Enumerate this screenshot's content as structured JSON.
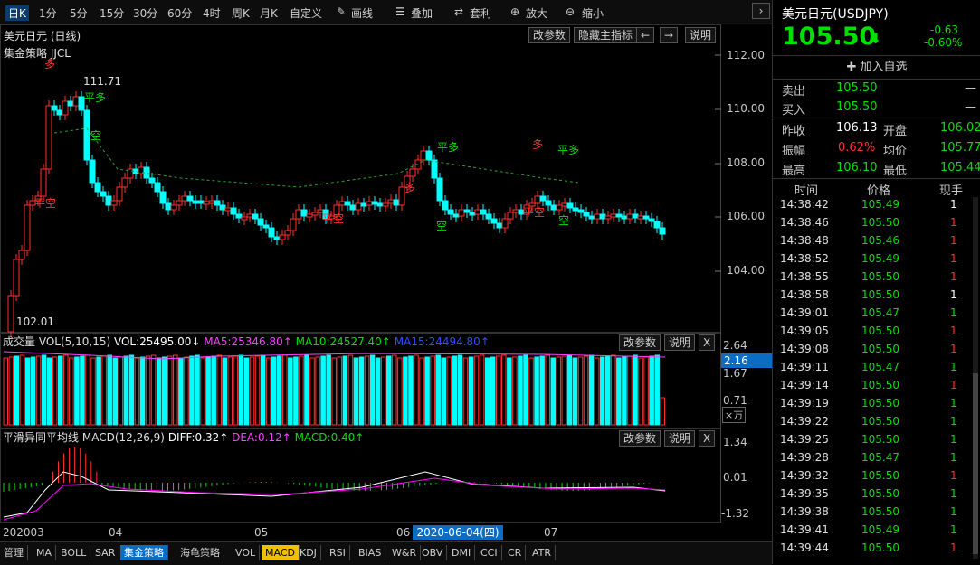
{
  "toolbar": {
    "periods": [
      "日K",
      "1分",
      "5分",
      "15分",
      "30分",
      "60分",
      "4时",
      "周K",
      "月K",
      "自定义"
    ],
    "tools": [
      "画线",
      "叠加",
      "套利",
      "放大",
      "缩小"
    ],
    "active_period": "日K"
  },
  "main_chart": {
    "symbol_title": "美元日元 (日线)",
    "buttons": [
      "改参数",
      "隐藏主指标",
      "←",
      "→",
      "说明"
    ],
    "indicator_label": "集金策略 JJCL",
    "price_axis": [
      "112.00",
      "110.00",
      "108.00",
      "106.00",
      "104.00"
    ],
    "high_label": "111.71",
    "low_label": "102.01",
    "signals": [
      "多",
      "平空",
      "平多",
      "空",
      "平空",
      "多",
      "平多",
      "空",
      "多",
      "平空",
      "平多",
      "空"
    ]
  },
  "volume_panel": {
    "title": "成交量",
    "vol_label": "VOL(5,10,15)",
    "vol_value": "VOL:25495.00↓",
    "ma5": "MA5:25346.80↑",
    "ma10": "MA10:24527.40↑",
    "ma15": "MA15:24494.80↑",
    "buttons": [
      "改参数",
      "说明",
      "X"
    ],
    "axis": [
      "2.64",
      "1.67",
      "0.71"
    ],
    "current": "2.16",
    "unit": "×万"
  },
  "macd_panel": {
    "title": "平滑异同平均线",
    "macd_label": "MACD(12,26,9)",
    "diff": "DIFF:0.32↑",
    "dea": "DEA:0.12↑",
    "macd": "MACD:0.40↑",
    "buttons": [
      "改参数",
      "说明",
      "X"
    ],
    "axis": [
      "1.34",
      "0.01",
      "-1.32"
    ]
  },
  "date_axis": {
    "labels": [
      "202003",
      "04",
      "05",
      "06",
      "07"
    ],
    "cursor_date": "2020-06-04(四)"
  },
  "bottom_tabs": [
    "管理",
    "MA",
    "BOLL",
    "SAR",
    "集金策略",
    "海龟策略",
    "VOL",
    "MACD",
    "KDJ",
    "RSI",
    "BIAS",
    "W&R",
    "OBV",
    "DMI",
    "CCI",
    "CR",
    "ATR"
  ],
  "quote": {
    "name": "美元日元",
    "code": "(USDJPY)",
    "price": "105.50",
    "arrow": "⬇",
    "change": "-0.63",
    "change_pct": "-0.60%",
    "add_watch": "✚ 加入自选",
    "sell_label": "卖出",
    "sell_price": "105.50",
    "sell_vol": "—",
    "buy_label": "买入",
    "buy_price": "105.50",
    "buy_vol": "—",
    "stats": [
      {
        "l1": "昨收",
        "v1": "106.13",
        "l2": "开盘",
        "v2": "106.02"
      },
      {
        "l1": "振幅",
        "v1": "0.62%",
        "l2": "均价",
        "v2": "105.77"
      },
      {
        "l1": "最高",
        "v1": "106.10",
        "l2": "最低",
        "v2": "105.44"
      }
    ]
  },
  "trades": {
    "headers": [
      "时间",
      "价格",
      "现手"
    ],
    "rows": [
      [
        "14:38:42",
        "105.49",
        "1"
      ],
      [
        "14:38:46",
        "105.50",
        "1"
      ],
      [
        "14:38:48",
        "105.46",
        "1"
      ],
      [
        "14:38:52",
        "105.49",
        "1"
      ],
      [
        "14:38:55",
        "105.50",
        "1"
      ],
      [
        "14:38:58",
        "105.50",
        "1"
      ],
      [
        "14:39:01",
        "105.47",
        "1"
      ],
      [
        "14:39:05",
        "105.50",
        "1"
      ],
      [
        "14:39:08",
        "105.50",
        "1"
      ],
      [
        "14:39:11",
        "105.47",
        "1"
      ],
      [
        "14:39:14",
        "105.50",
        "1"
      ],
      [
        "14:39:19",
        "105.50",
        "1"
      ],
      [
        "14:39:22",
        "105.50",
        "1"
      ],
      [
        "14:39:25",
        "105.50",
        "1"
      ],
      [
        "14:39:28",
        "105.47",
        "1"
      ],
      [
        "14:39:32",
        "105.50",
        "1"
      ],
      [
        "14:39:35",
        "105.50",
        "1"
      ],
      [
        "14:39:38",
        "105.50",
        "1"
      ],
      [
        "14:39:41",
        "105.49",
        "1"
      ],
      [
        "14:39:44",
        "105.50",
        "1"
      ]
    ],
    "vol_colors": [
      "white",
      "red",
      "red",
      "red",
      "red",
      "white",
      "green",
      "red",
      "red",
      "green",
      "red",
      "green",
      "green",
      "green",
      "green",
      "red",
      "green",
      "green",
      "green",
      "red"
    ]
  },
  "colors": {
    "up": "#ff3030",
    "down": "#00ffff",
    "price_green": "#00e000",
    "macd_diff": "#ffffff",
    "macd_dea": "#ff00ff",
    "accent_blue": "#0b6cc4"
  }
}
